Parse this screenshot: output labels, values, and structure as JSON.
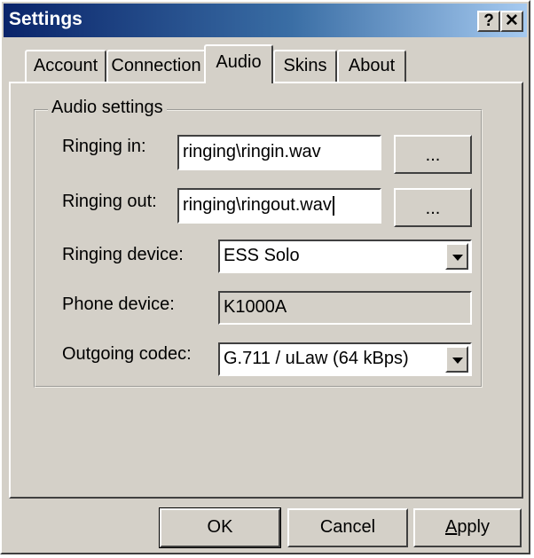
{
  "window": {
    "title": "Settings",
    "help_glyph": "?",
    "close_glyph": "✕"
  },
  "tabs": [
    "Account",
    "Connection",
    "Audio",
    "Skins",
    "About"
  ],
  "active_tab": "Audio",
  "audio": {
    "group_label": "Audio settings",
    "ringing_in_label": "Ringing in:",
    "ringing_in_value": "ringing\\ringin.wav",
    "ringing_out_label": "Ringing out:",
    "ringing_out_value": "ringing\\ringout.wav",
    "browse_label": "...",
    "ringing_device_label": "Ringing device:",
    "ringing_device_value": "ESS Solo",
    "phone_device_label": "Phone device:",
    "phone_device_value": "K1000A",
    "codec_label": "Outgoing codec:",
    "codec_value": "G.711 / uLaw (64 kBps)"
  },
  "buttons": {
    "ok": "OK",
    "cancel": "Cancel",
    "apply_first": "A",
    "apply_rest": "pply"
  }
}
